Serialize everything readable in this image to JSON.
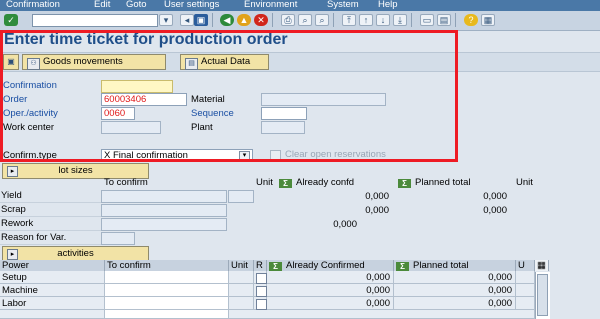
{
  "menu": [
    "Confirmation",
    "Edit",
    "Goto",
    "User settings",
    "Environment",
    "System",
    "Help"
  ],
  "title": "Enter time ticket for production order",
  "app_toolbar": {
    "goods_movements": "Goods movements",
    "actual_data": "Actual Data"
  },
  "header_fields": {
    "confirmation_label": "Confirmation",
    "order_label": "Order",
    "order_value": "60003406",
    "material_label": "Material",
    "oper_label": "Oper./activity",
    "oper_value": "0060",
    "sequence_label": "Sequence",
    "work_center_label": "Work center",
    "plant_label": "Plant",
    "confirm_type_label": "Confirm.type",
    "confirm_type_value": "X Final confirmation",
    "clear_reservations_label": "Clear open reservations"
  },
  "lot_sizes": {
    "button": "lot sizes",
    "col_to_confirm": "To confirm",
    "col_unit": "Unit",
    "col_already": "Already confd",
    "col_planned": "Planned total",
    "col_unit2": "Unit",
    "rows": [
      {
        "label": "Yield",
        "already": "0,000",
        "planned": "0,000"
      },
      {
        "label": "Scrap",
        "already": "0,000",
        "planned": "0,000"
      },
      {
        "label": "Rework",
        "already": "0,000",
        "planned": ""
      }
    ],
    "reason_label": "Reason for Var."
  },
  "activities": {
    "button": "activities",
    "columns": [
      "Power",
      "To confirm",
      "Unit",
      "R",
      "Already Confirmed",
      "Planned total",
      "U"
    ],
    "rows": [
      {
        "power": "Setup",
        "already": "0,000",
        "planned": "0,000"
      },
      {
        "power": "Machine",
        "already": "0,000",
        "planned": "0,000"
      },
      {
        "power": "Labor",
        "already": "0,000",
        "planned": "0,000"
      }
    ]
  },
  "colors": {
    "title": "#1f4e89",
    "highlight": "#ee1b24",
    "menubar": "#4a78a7",
    "button": "#f2e3a6"
  },
  "icons": [
    "check-icon",
    "save-icon",
    "back-icon",
    "exit-icon",
    "cancel-icon",
    "print-icon",
    "find-icon",
    "help-icon",
    "layout-icon",
    "goods-movements-icon",
    "actual-data-icon",
    "sigma-icon"
  ]
}
